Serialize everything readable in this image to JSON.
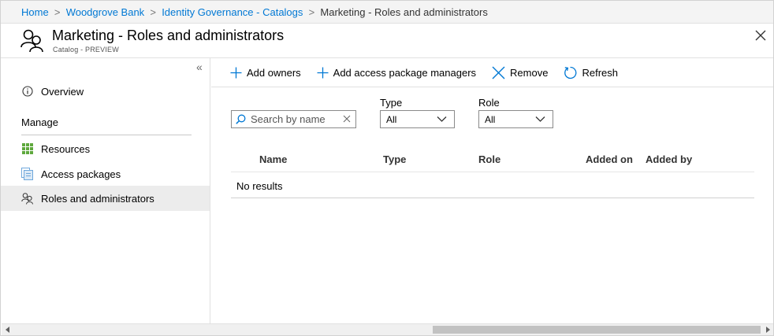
{
  "breadcrumb": {
    "items": [
      "Home",
      "Woodgrove Bank",
      "Identity Governance - Catalogs"
    ],
    "current": "Marketing - Roles and administrators",
    "separator": ">"
  },
  "blade": {
    "title": "Marketing - Roles and administrators",
    "subtitle": "Catalog - PREVIEW",
    "icon": "roles-people-icon",
    "close_icon": "close-icon"
  },
  "leftmenu": {
    "collapse_icon": "«",
    "overview": "Overview",
    "section": "Manage",
    "items": [
      {
        "label": "Resources",
        "icon": "grid-resources-icon"
      },
      {
        "label": "Access packages",
        "icon": "access-packages-icon"
      },
      {
        "label": "Roles and administrators",
        "icon": "roles-icon",
        "selected": true
      }
    ]
  },
  "toolbar": {
    "add_owners": "Add owners",
    "add_managers": "Add access package managers",
    "remove": "Remove",
    "refresh": "Refresh"
  },
  "filters": {
    "search_placeholder": "Search by name",
    "type_label": "Type",
    "type_value": "All",
    "role_label": "Role",
    "role_value": "All"
  },
  "grid": {
    "columns": [
      "Name",
      "Type",
      "Role",
      "Added on",
      "Added by"
    ],
    "empty_text": "No results"
  },
  "colors": {
    "accent": "#0078d4",
    "selected_bg": "#ececec",
    "border": "#e1e1e1"
  }
}
